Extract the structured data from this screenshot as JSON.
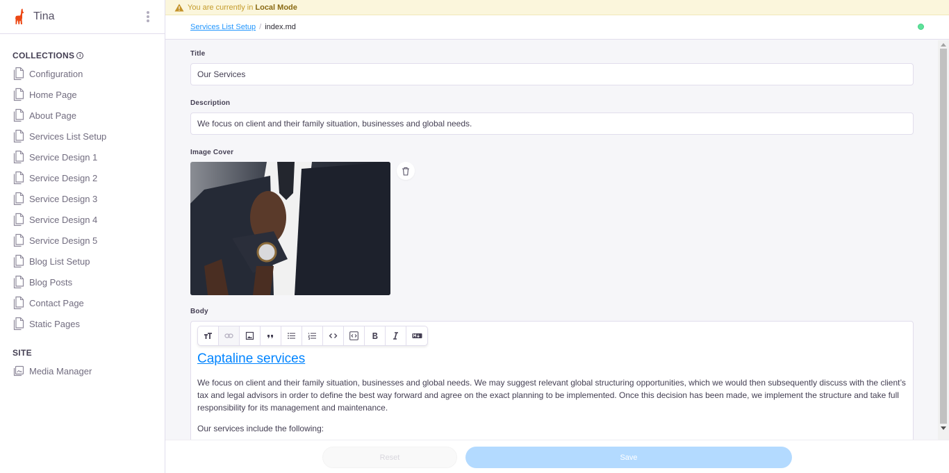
{
  "app": {
    "title": "Tina",
    "logo_color": "#ec4815"
  },
  "sidebar": {
    "collections_heading": "COLLECTIONS",
    "collections": [
      {
        "label": "Configuration",
        "icon": "document-icon"
      },
      {
        "label": "Home Page",
        "icon": "document-icon"
      },
      {
        "label": "About Page",
        "icon": "document-icon"
      },
      {
        "label": "Services List Setup",
        "icon": "document-icon"
      },
      {
        "label": "Service Design 1",
        "icon": "document-icon"
      },
      {
        "label": "Service Design 2",
        "icon": "document-icon"
      },
      {
        "label": "Service Design 3",
        "icon": "document-icon"
      },
      {
        "label": "Service Design 4",
        "icon": "document-icon"
      },
      {
        "label": "Service Design 5",
        "icon": "document-icon"
      },
      {
        "label": "Blog List Setup",
        "icon": "document-icon"
      },
      {
        "label": "Blog Posts",
        "icon": "document-icon"
      },
      {
        "label": "Contact Page",
        "icon": "document-icon"
      },
      {
        "label": "Static Pages",
        "icon": "document-icon"
      }
    ],
    "site_heading": "SITE",
    "site_items": [
      {
        "label": "Media Manager",
        "icon": "image-gallery-icon"
      }
    ]
  },
  "banner": {
    "prefix": "You are currently in",
    "mode": "Local Mode"
  },
  "breadcrumb": {
    "parent": "Services List Setup",
    "separator": "/",
    "current": "index.md",
    "status_color": "#5ee29a"
  },
  "form": {
    "title_label": "Title",
    "title_value": "Our Services",
    "description_label": "Description",
    "description_value": "We focus on client and their family situation, businesses and global needs.",
    "image_label": "Image Cover",
    "body_label": "Body",
    "toolbar": [
      {
        "name": "heading",
        "icon": "text-size-icon"
      },
      {
        "name": "link",
        "icon": "link-icon",
        "active": true
      },
      {
        "name": "image",
        "icon": "image-icon"
      },
      {
        "name": "quote",
        "icon": "quote-icon"
      },
      {
        "name": "bullet-list",
        "icon": "bullet-list-icon"
      },
      {
        "name": "ordered-list",
        "icon": "ordered-list-icon"
      },
      {
        "name": "code",
        "icon": "code-icon"
      },
      {
        "name": "code-block",
        "icon": "code-block-icon"
      },
      {
        "name": "bold",
        "icon": "bold-icon"
      },
      {
        "name": "italic",
        "icon": "italic-icon"
      },
      {
        "name": "markdown",
        "icon": "markdown-icon"
      }
    ],
    "body_heading": "Captaline services",
    "body_paragraphs": [
      "We focus on client and their family situation, businesses and global needs. We may suggest relevant global structuring opportunities, which we would then subsequently discuss with the client’s tax and legal advisors in order to define the best way forward and agree on the exact planning to be implemented. Once this decision has been made, we implement the structure and take full responsibility for its management and maintenance.",
      "Our services include the following:"
    ]
  },
  "footer": {
    "reset_label": "Reset",
    "save_label": "Save"
  }
}
